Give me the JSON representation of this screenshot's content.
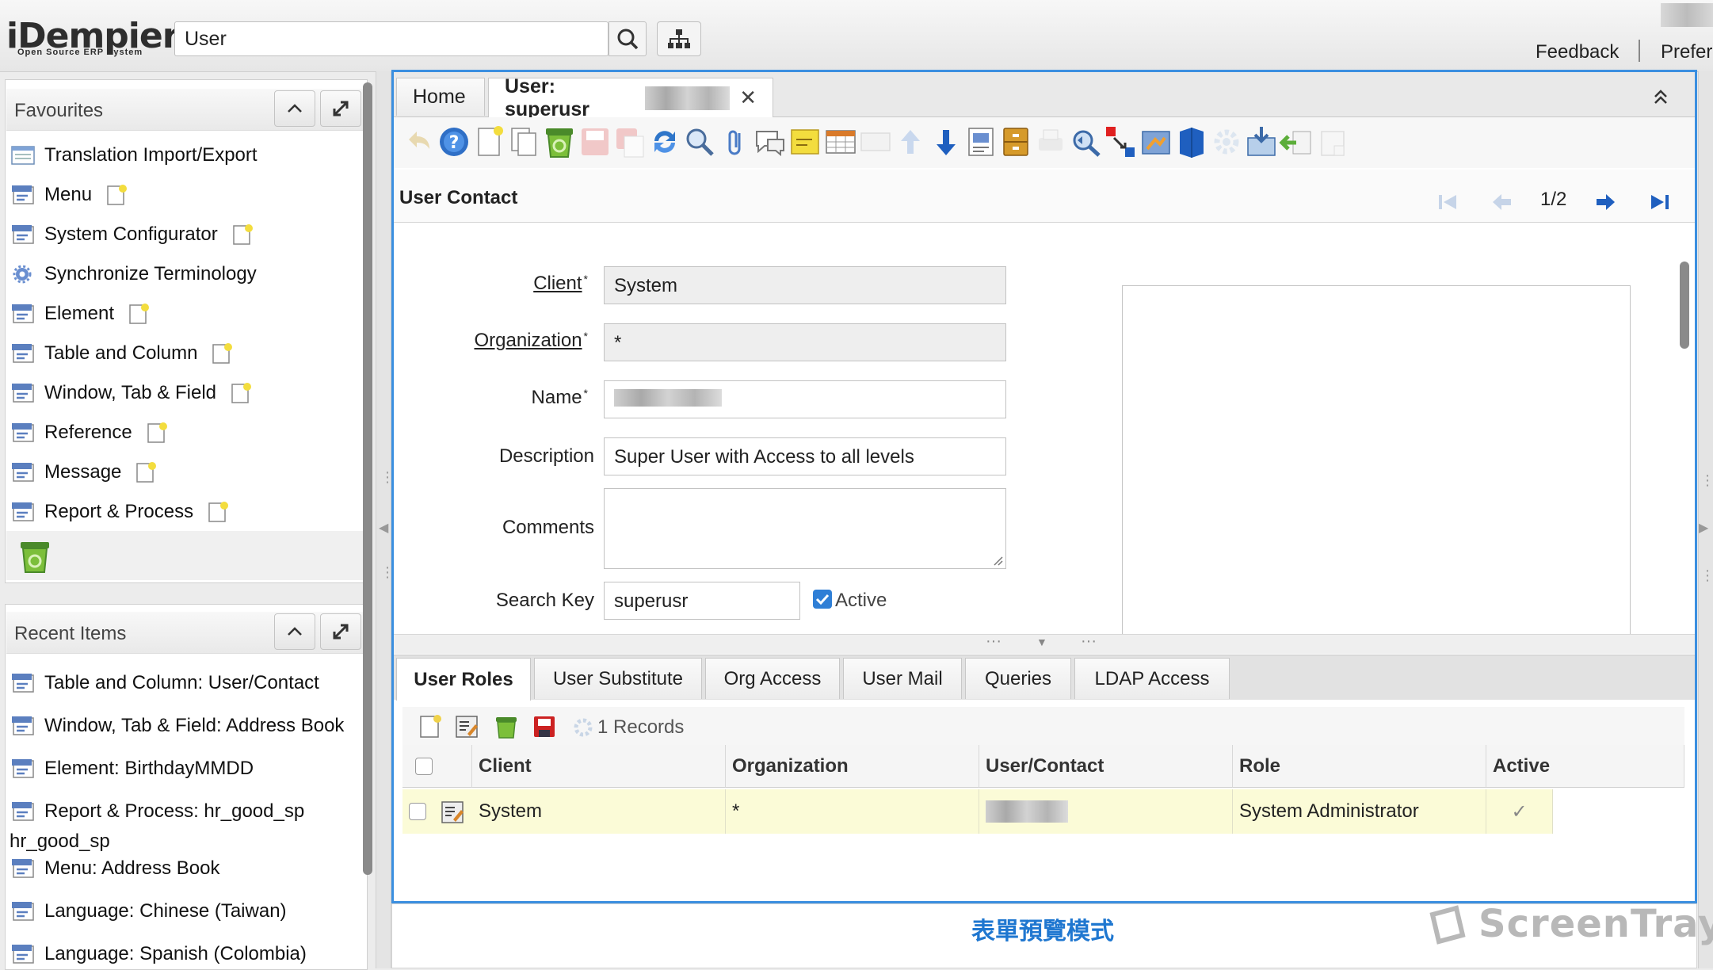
{
  "app": {
    "logo": "iDempiere",
    "logo_tagline": "Open Source ERP System",
    "search_value": "User",
    "feedback": "Feedback",
    "preferences": "Prefer"
  },
  "favourites": {
    "title": "Favourites",
    "items": [
      {
        "label": "Translation Import/Export",
        "icon": "list-icon",
        "note": false
      },
      {
        "label": "Menu",
        "icon": "window-icon",
        "note": true
      },
      {
        "label": "System Configurator",
        "icon": "window-icon",
        "note": true
      },
      {
        "label": "Synchronize Terminology",
        "icon": "gear-icon",
        "note": false
      },
      {
        "label": "Element",
        "icon": "window-icon",
        "note": true
      },
      {
        "label": "Table and Column",
        "icon": "window-icon",
        "note": true
      },
      {
        "label": "Window, Tab & Field",
        "icon": "window-icon",
        "note": true
      },
      {
        "label": "Reference",
        "icon": "window-icon",
        "note": true
      },
      {
        "label": "Message",
        "icon": "window-icon",
        "note": true
      },
      {
        "label": "Report & Process",
        "icon": "window-icon",
        "note": true
      }
    ]
  },
  "recent": {
    "title": "Recent Items",
    "items": [
      {
        "label": "Table and Column: User/Contact"
      },
      {
        "label": "Window, Tab & Field: Address Book"
      },
      {
        "label": "Element: BirthdayMMDD"
      },
      {
        "label": "Report & Process: hr_good_sp",
        "label2": "hr_good_sp"
      },
      {
        "label": "Menu: Address Book"
      },
      {
        "label": "Language: Chinese (Taiwan)"
      },
      {
        "label": "Language: Spanish (Colombia)"
      }
    ]
  },
  "window": {
    "tabs": [
      {
        "label": "Home"
      },
      {
        "label": "User: superusr"
      }
    ],
    "header_title": "User Contact",
    "record_counter": "1/2",
    "fields": {
      "client_label": "Client",
      "client_value": "System",
      "org_label": "Organization",
      "org_value": "*",
      "name_label": "Name",
      "description_label": "Description",
      "description_value": "Super User with Access to all levels",
      "comments_label": "Comments",
      "comments_value": "",
      "search_key_label": "Search Key",
      "search_key_value": "superusr",
      "active_label": "Active"
    }
  },
  "detail": {
    "tabs": [
      "User Roles",
      "User Substitute",
      "Org Access",
      "User Mail",
      "Queries",
      "LDAP Access"
    ],
    "records": "1 Records",
    "columns": [
      "Client",
      "Organization",
      "User/Contact",
      "Role",
      "Active"
    ],
    "rows": [
      {
        "client": "System",
        "organization": "*",
        "role": "System Administrator",
        "active": "✓"
      }
    ]
  },
  "footer": {
    "mode_caption": "表單預覽模式",
    "brand": "ScreenTray"
  },
  "colors": {
    "focus_border": "#3b8fe0",
    "row_highlight": "#fbfbd7",
    "nav_arrow": "#1f5fbf"
  }
}
